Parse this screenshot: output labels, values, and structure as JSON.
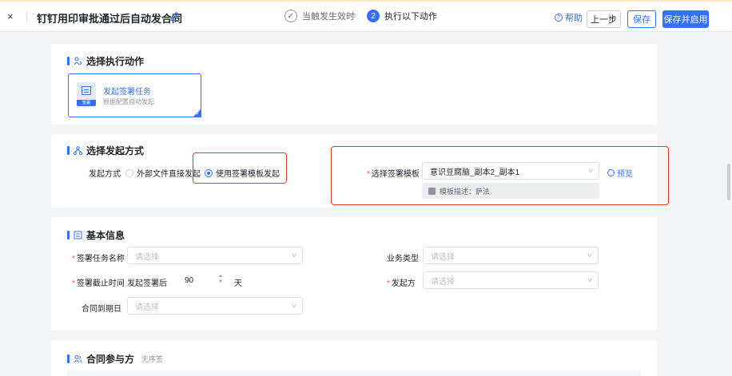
{
  "header": {
    "close_glyph": "×",
    "title": "钉钉用印审批通过后自动发合同",
    "steps": [
      {
        "label": "当触发生效时",
        "state": "done"
      },
      {
        "number": "2",
        "label": "执行以下动作",
        "state": "active"
      }
    ],
    "help_label": "帮助",
    "prev_label": "上一步",
    "save_label": "保存",
    "save_enable_label": "保存并启用"
  },
  "action_section": {
    "title": "选择执行动作",
    "card": {
      "name": "发起签署任务",
      "desc": "根据配置自动发起",
      "tag": "签署"
    }
  },
  "initiate_section": {
    "title": "选择发起方式",
    "method_label": "发起方式",
    "options": [
      "外部文件直接发起",
      "使用签署模板发起"
    ],
    "selected": "使用签署模板发起",
    "template_label": "选择签署模板",
    "template_value": "意识豆腐脑_副本2_副本1",
    "template_desc": "模板描述：萨法",
    "preview_label": "预览"
  },
  "basic_section": {
    "title": "基本信息",
    "task_name_label": "签署任务名称",
    "task_name_placeholder": "请选择",
    "biz_type_label": "业务类型",
    "biz_type_placeholder": "请选择",
    "deadline_label": "签署截止时间",
    "deadline_prefix": "发起签署后",
    "deadline_value": "90",
    "deadline_unit": "天",
    "initiator_label": "发起方",
    "initiator_placeholder": "请选择",
    "expiry_label": "合同到期日",
    "expiry_placeholder": "请选择"
  },
  "participants_section": {
    "title": "合同参与方",
    "note": "无序签"
  },
  "colors": {
    "accent": "#3370ff",
    "highlight": "#e03a2f",
    "required": "#f54a45"
  }
}
